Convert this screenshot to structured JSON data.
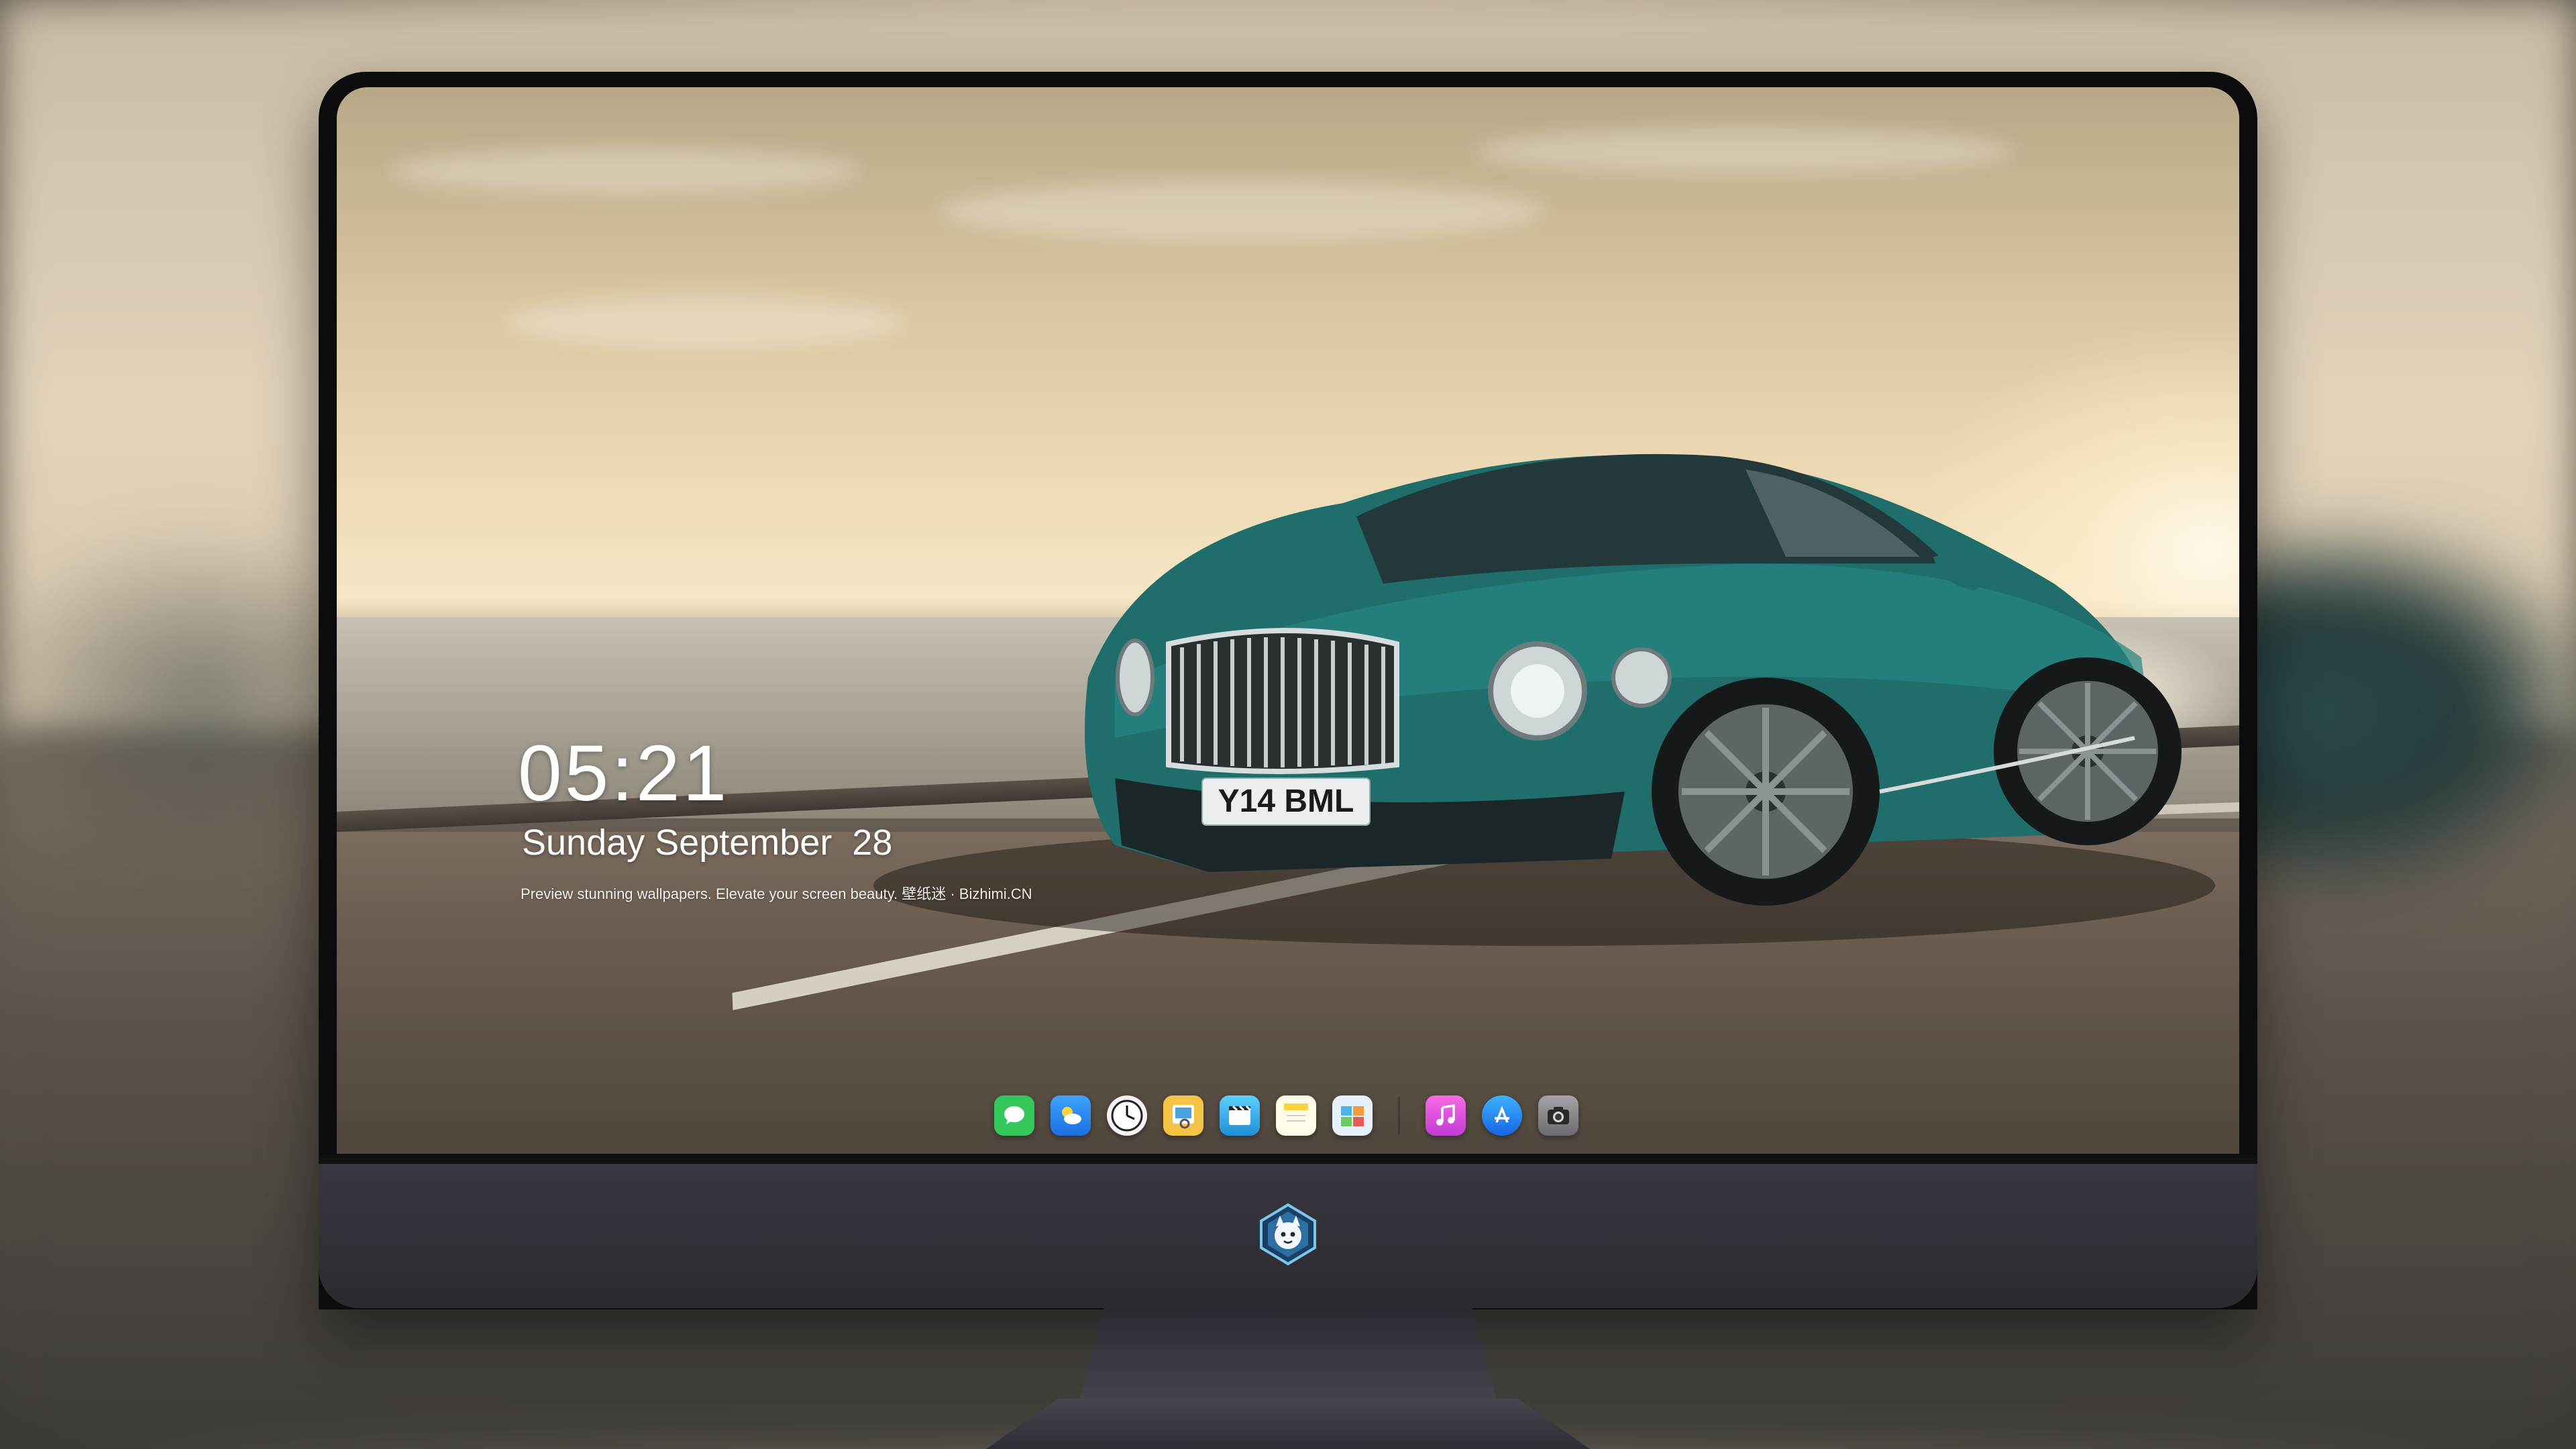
{
  "lockscreen": {
    "time": "05:21",
    "date": "Sunday September  28",
    "tagline": "Preview stunning wallpapers. Elevate your screen beauty. 壁纸迷 · Bizhimi.CN"
  },
  "wallpaper": {
    "plate": "Y14 BML",
    "car_color": "#1f6e6c"
  },
  "dock": {
    "items": [
      {
        "name": "messages-icon",
        "color": "#34c759"
      },
      {
        "name": "weather-icon",
        "color": "#2f8cf5"
      },
      {
        "name": "clock-icon",
        "color": "#f2f2f2"
      },
      {
        "name": "preview-icon",
        "color": "#f6c445"
      },
      {
        "name": "clips-icon",
        "color": "#37b3f0"
      },
      {
        "name": "notes-icon",
        "color": "#fff2a8"
      },
      {
        "name": "photo-gallery-icon",
        "color": "#4db6e8"
      },
      {
        "name": "music-icon",
        "color": "#e64fd0"
      },
      {
        "name": "app-store-icon",
        "color": "#1f86f5"
      },
      {
        "name": "camera-icon",
        "color": "#8e8e93"
      }
    ]
  },
  "colors": {
    "monitor_chin": "#2f2c34",
    "bezel": "#0c0c0e"
  }
}
